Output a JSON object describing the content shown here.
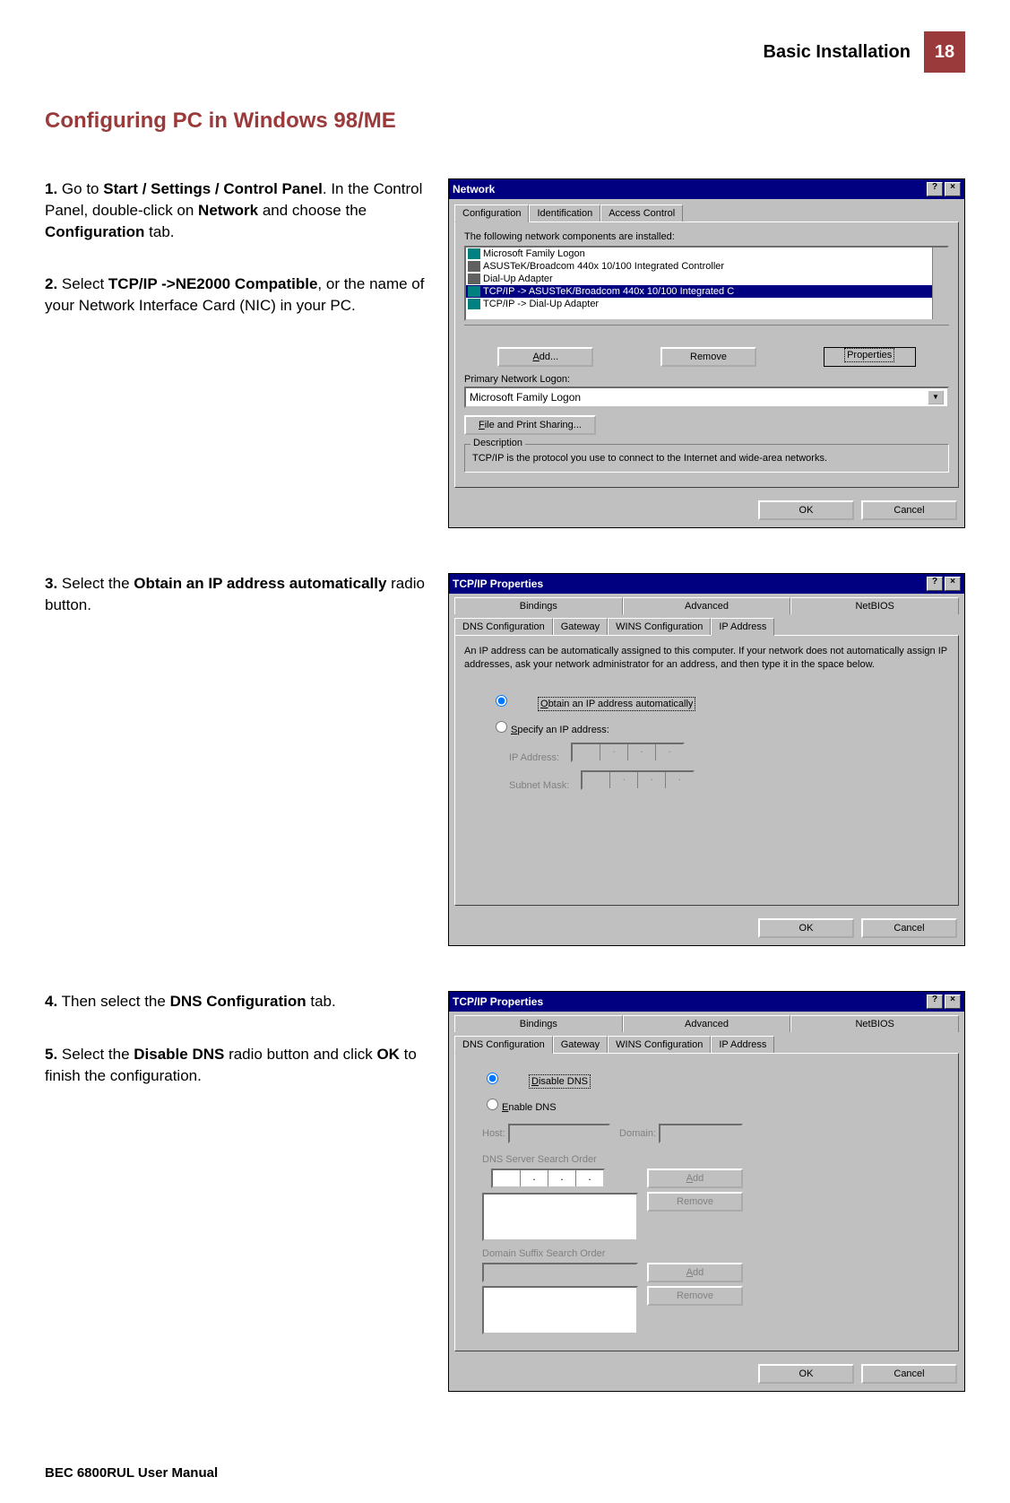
{
  "header": {
    "title": "Basic Installation",
    "page": "18"
  },
  "section_title": "Configuring PC in Windows 98/ME",
  "steps": {
    "s1": {
      "num": "1.",
      "a": "Go to ",
      "b": "Start / Settings / Control Panel",
      "c": ". In the Control Panel, double-click on ",
      "d": "Network",
      "e": " and choose the ",
      "f": "Configuration",
      "g": " tab."
    },
    "s2": {
      "num": "2.",
      "a": "Select ",
      "b": "TCP/IP ->NE2000 Compatible",
      "c": ", or the name of your Network Interface Card (NIC) in your PC."
    },
    "s3": {
      "num": "3.",
      "a": "Select the ",
      "b": "Obtain an IP address automatically",
      "c": " radio button."
    },
    "s4": {
      "num": "4.",
      "a": "Then select the ",
      "b": "DNS Configuration",
      "c": " tab."
    },
    "s5": {
      "num": "5.",
      "a": "Select the ",
      "b": "Disable DNS",
      "c": " radio button and click ",
      "d": "OK",
      "e": " to finish the configuration."
    }
  },
  "win1": {
    "title": "Network",
    "tabs": {
      "t1": "Configuration",
      "t2": "Identification",
      "t3": "Access Control"
    },
    "label_installed": "The following network components are installed:",
    "items": {
      "i1": "Microsoft Family Logon",
      "i2": "ASUSTeK/Broadcom 440x 10/100 Integrated Controller",
      "i3": "Dial-Up Adapter",
      "i4": "TCP/IP -> ASUSTeK/Broadcom 440x 10/100 Integrated C",
      "i5": "TCP/IP -> Dial-Up Adapter"
    },
    "btn_add": "Add...",
    "btn_remove": "Remove",
    "btn_props": "Properties",
    "label_logon": "Primary Network Logon:",
    "logon_value": "Microsoft Family Logon",
    "btn_share": "File and Print Sharing...",
    "desc_label": "Description",
    "desc_text": "TCP/IP is the protocol you use to connect to the Internet and wide-area networks.",
    "btn_ok": "OK",
    "btn_cancel": "Cancel"
  },
  "win2": {
    "title": "TCP/IP Properties",
    "tabs_top": {
      "t1": "Bindings",
      "t2": "Advanced",
      "t3": "NetBIOS"
    },
    "tabs_bot": {
      "t1": "DNS Configuration",
      "t2": "Gateway",
      "t3": "WINS Configuration",
      "t4": "IP Address"
    },
    "intro": "An IP address can be automatically assigned to this computer. If your network does not automatically assign IP addresses, ask your network administrator for an address, and then type it in the space below.",
    "radio1": "Obtain an IP address automatically",
    "radio2": "Specify an IP address:",
    "label_ip": "IP Address:",
    "label_mask": "Subnet Mask:",
    "btn_ok": "OK",
    "btn_cancel": "Cancel"
  },
  "win3": {
    "title": "TCP/IP Properties",
    "tabs_top": {
      "t1": "Bindings",
      "t2": "Advanced",
      "t3": "NetBIOS"
    },
    "tabs_bot": {
      "t1": "DNS Configuration",
      "t2": "Gateway",
      "t3": "WINS Configuration",
      "t4": "IP Address"
    },
    "radio1": "Disable DNS",
    "radio2": "Enable DNS",
    "label_host": "Host:",
    "label_domain": "Domain:",
    "label_dns_order": "DNS Server Search Order",
    "label_suffix": "Domain Suffix Search Order",
    "btn_add": "Add",
    "btn_remove": "Remove",
    "btn_ok": "OK",
    "btn_cancel": "Cancel"
  },
  "footer": "BEC 6800RUL User Manual"
}
